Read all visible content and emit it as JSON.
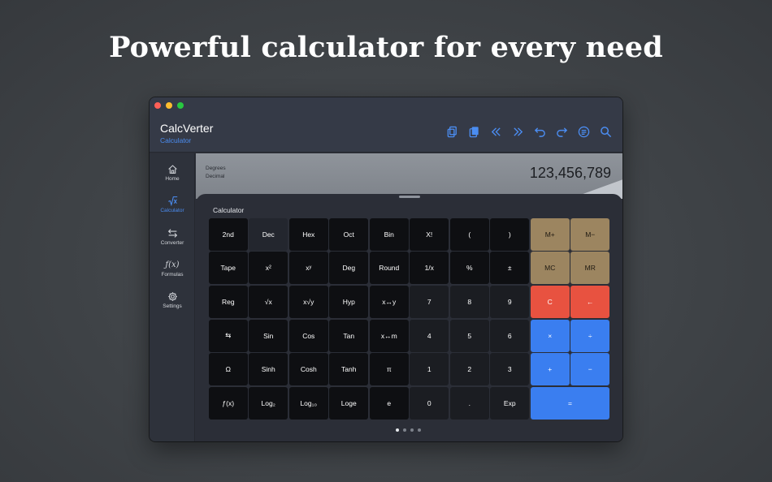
{
  "headline": "Powerful calculator for every need",
  "window": {
    "app_title": "CalcVerter",
    "app_subtitle": "Calculator",
    "toolbar_icons": [
      "copy-icon",
      "paste-icon",
      "rewind-icon",
      "fast-forward-icon",
      "undo-icon",
      "redo-icon",
      "list-icon",
      "search-icon"
    ]
  },
  "sidebar": {
    "items": [
      {
        "label": "Home",
        "icon": "home-icon"
      },
      {
        "label": "Calculator",
        "icon": "sqrt-icon",
        "active": true
      },
      {
        "label": "Converter",
        "icon": "swap-icon"
      },
      {
        "label": "Formulas",
        "icon": "function-icon"
      },
      {
        "label": "Settings",
        "icon": "gear-icon"
      }
    ]
  },
  "display": {
    "angle_mode": "Degrees",
    "number_mode": "Decimal",
    "value": "123,456,789"
  },
  "sheet": {
    "title": "Calculator",
    "page_count": 4,
    "current_page": 1
  },
  "keys": [
    {
      "label": "2nd",
      "kind": "fn"
    },
    {
      "label": "Dec",
      "kind": "fn2"
    },
    {
      "label": "Hex",
      "kind": "fn"
    },
    {
      "label": "Oct",
      "kind": "fn"
    },
    {
      "label": "Bin",
      "kind": "fn"
    },
    {
      "label": "X!",
      "kind": "fn"
    },
    {
      "label": "(",
      "kind": "fn"
    },
    {
      "label": ")",
      "kind": "fn"
    },
    {
      "label": "M+",
      "kind": "mem"
    },
    {
      "label": "M−",
      "kind": "mem"
    },
    {
      "label": "Tape",
      "kind": "fn"
    },
    {
      "label": "x²",
      "kind": "fn"
    },
    {
      "label": "xʸ",
      "kind": "fn"
    },
    {
      "label": "Deg",
      "kind": "fn"
    },
    {
      "label": "Round",
      "kind": "fn"
    },
    {
      "label": "1/x",
      "kind": "fn"
    },
    {
      "label": "%",
      "kind": "fn"
    },
    {
      "label": "±",
      "kind": "fn"
    },
    {
      "label": "MC",
      "kind": "mem"
    },
    {
      "label": "MR",
      "kind": "mem"
    },
    {
      "label": "Reg",
      "kind": "fn"
    },
    {
      "label": "√x",
      "kind": "fn"
    },
    {
      "label": "x√y",
      "kind": "fn"
    },
    {
      "label": "Hyp",
      "kind": "fn"
    },
    {
      "label": "x↔y",
      "kind": "fn"
    },
    {
      "label": "7",
      "kind": "num"
    },
    {
      "label": "8",
      "kind": "num"
    },
    {
      "label": "9",
      "kind": "num"
    },
    {
      "label": "C",
      "kind": "red"
    },
    {
      "label": "←",
      "kind": "red"
    },
    {
      "label": "⇆",
      "kind": "fn"
    },
    {
      "label": "Sin",
      "kind": "fn"
    },
    {
      "label": "Cos",
      "kind": "fn"
    },
    {
      "label": "Tan",
      "kind": "fn"
    },
    {
      "label": "x↔m",
      "kind": "fn"
    },
    {
      "label": "4",
      "kind": "num"
    },
    {
      "label": "5",
      "kind": "num"
    },
    {
      "label": "6",
      "kind": "num"
    },
    {
      "label": "×",
      "kind": "blue"
    },
    {
      "label": "÷",
      "kind": "blue"
    },
    {
      "label": "Ω",
      "kind": "fn"
    },
    {
      "label": "Sinh",
      "kind": "fn"
    },
    {
      "label": "Cosh",
      "kind": "fn"
    },
    {
      "label": "Tanh",
      "kind": "fn"
    },
    {
      "label": "π",
      "kind": "fn"
    },
    {
      "label": "1",
      "kind": "num"
    },
    {
      "label": "2",
      "kind": "num"
    },
    {
      "label": "3",
      "kind": "num"
    },
    {
      "label": "+",
      "kind": "blue"
    },
    {
      "label": "−",
      "kind": "blue"
    },
    {
      "label": "ƒ(x)",
      "kind": "fn"
    },
    {
      "label": "Log₂",
      "kind": "fn"
    },
    {
      "label": "Log₁₀",
      "kind": "fn"
    },
    {
      "label": "Loge",
      "kind": "fn"
    },
    {
      "label": "e",
      "kind": "fn"
    },
    {
      "label": "0",
      "kind": "num"
    },
    {
      "label": ".",
      "kind": "num"
    },
    {
      "label": "Exp",
      "kind": "num"
    },
    {
      "label": "=",
      "kind": "blue",
      "wide": true
    }
  ],
  "colors": {
    "accent": "#4b8df2",
    "memory_key": "#9c8560",
    "clear_key": "#e85240",
    "operator_key": "#3a7ef0"
  }
}
